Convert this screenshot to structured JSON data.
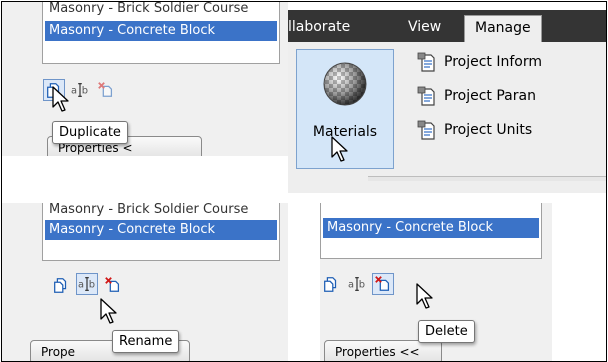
{
  "material_list": {
    "rows_top": [
      "Masonry - Brick Soldier Course",
      "Masonry - Concrete Block"
    ],
    "rows_rename": [
      "Masonry - Brick Soldier Course",
      "Masonry - Concrete Block"
    ],
    "rows_delete": [
      "Masonry - Concrete Block"
    ]
  },
  "tooltips": {
    "duplicate": "Duplicate",
    "rename": "Rename",
    "delete": "Delete"
  },
  "properties_button": {
    "top_label": "Properties <",
    "rename_label": "Prope",
    "delete_label": "Properties <<"
  },
  "ribbon": {
    "tabs": [
      "llaborate",
      "View",
      "Manage"
    ],
    "active_tab": "Manage",
    "materials_label": "Materials",
    "items": [
      "Project Inform",
      "Project Paran",
      "Project Units"
    ]
  },
  "colors": {
    "selection": "#3b73c8",
    "ribbon_dark": "#343434",
    "hover_fill": "#d4e6f8"
  },
  "icons": [
    "duplicate-icon",
    "rename-icon",
    "delete-icon",
    "materials-sphere-icon",
    "project-information-icon",
    "project-parameters-icon",
    "project-units-icon",
    "mouse-pointer-icon"
  ]
}
